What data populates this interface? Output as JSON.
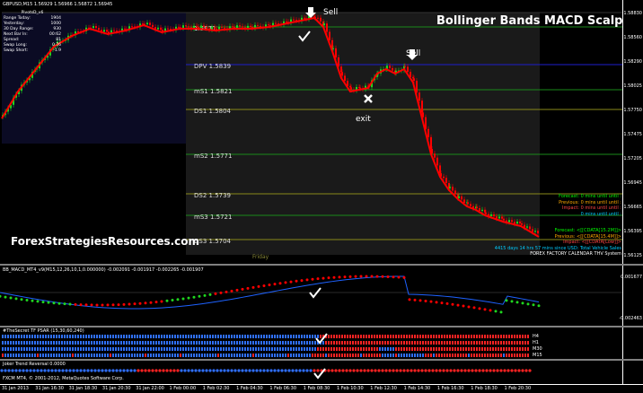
{
  "window_title": "GBPUSD,M15  1.56929 1.56966 1.56872 1.56945",
  "chart_title": "Bollinger Bands MACD Scalping",
  "watermark": "ForexStrategiesResources.com",
  "pivot_box": {
    "header": "PivotsD_v6",
    "rows": [
      {
        "label": "Range Today:",
        "value": "1904"
      },
      {
        "label": "Yesterday:",
        "value": "1000"
      },
      {
        "label": "30 Day Range:",
        "value": "930"
      },
      {
        "label": "Next Bar In:",
        "value": "00:62"
      },
      {
        "label": "Spread:",
        "value": "81"
      },
      {
        "label": "Swap Long:",
        "value": "0.76"
      },
      {
        "label": "Swap Short:",
        "value": "-1.9"
      }
    ]
  },
  "levels": [
    {
      "label": "1.5871",
      "name": "",
      "color": "#1a8a1a"
    },
    {
      "label": "DPV  1.5839",
      "name": "",
      "color": "#1e1ecc"
    },
    {
      "label": "mS1  1.5821",
      "name": "",
      "color": "#1a8a1a"
    },
    {
      "label": "DS1  1.5804",
      "name": "",
      "color": "#8a8a1a"
    },
    {
      "label": "mS2  1.5771",
      "name": "",
      "color": "#1a8a1a"
    },
    {
      "label": "DS2  1.5739",
      "name": "",
      "color": "#8a8a1a"
    },
    {
      "label": "mS3  1.5721",
      "name": "",
      "color": "#1a8a1a"
    },
    {
      "label": "DS3  1.5704",
      "name": "",
      "color": "#8a8a1a"
    }
  ],
  "price_axis": [
    "1.58830",
    "1.58560",
    "1.58290",
    "1.58025",
    "1.57750",
    "1.57475",
    "1.57205",
    "1.56945",
    "1.56665",
    "1.56395",
    "1.56125"
  ],
  "annotations": {
    "sell1": "Sell",
    "sell2": "Sell",
    "exit": "exit",
    "friday": "Friday"
  },
  "info_panel": {
    "forecast": "Forecast: 0 mins until until :",
    "previous": "Previous: 0 mins until until :",
    "impact": "Impact: 0 mins until until :",
    "blank": "0 mins until until :",
    "forecast2": "Forecast: <[[CDATA[15.2M]]>",
    "previous2": "Previous: <[[CDATA[15.4M]]>",
    "impact2": "Impact: <[[CDATA[Low]]>",
    "days": "4415 days 14 hrs 57 mins since USD: Total Vehicle Sales",
    "calendar": "FOREX FACTORY CALENDAR THV System"
  },
  "macd_pane": {
    "title": "BB_MACD_MT4_v9(M15,12,26,10,1,0.000000) -0.002091 -0.001917 -0.002265 -0.001907",
    "axis": [
      "0.001677",
      "-0.002463"
    ]
  },
  "psar_pane": {
    "title": "#TheSecret TF PSAR (15,30,60,240)",
    "rows": [
      "H4",
      "H1",
      "M30",
      "M15"
    ]
  },
  "joker_pane": {
    "title": "Joker Trend Reversal 0.0000"
  },
  "footer": "FXCM MT4, © 2001-2012, MetaQuotes Software Corp.",
  "time_axis": [
    "31 Jan 2013",
    "31 Jan 16:30",
    "31 Jan 18:30",
    "31 Jan 20:30",
    "31 Jan 22:00",
    "1 Feb 00:00",
    "1 Feb 02:30",
    "1 Feb 04:30",
    "1 Feb 06:30",
    "1 Feb 08:30",
    "1 Feb 10:30",
    "1 Feb 12:30",
    "1 Feb 14:30",
    "1 Feb 16:30",
    "1 Feb 18:30",
    "1 Feb 20:30"
  ],
  "colors": {
    "bull": "#1fd61f",
    "bear": "#ff0000",
    "psar_blue": "#2f6fff",
    "psar_red": "#ff2222",
    "macd_signal": "#1e62ff",
    "macd_line": "#ff0000"
  }
}
